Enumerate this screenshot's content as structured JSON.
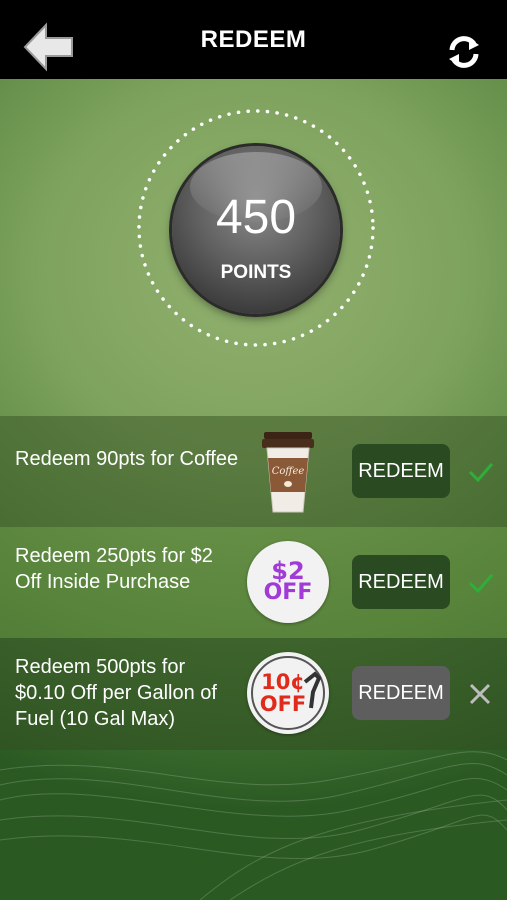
{
  "header": {
    "title": "REDEEM",
    "back_icon": "back-arrow-icon",
    "refresh_icon": "refresh-icon"
  },
  "points": {
    "value": "450",
    "label": "POINTS"
  },
  "rewards": [
    {
      "description": "Redeem 90pts for Coffee",
      "image": "coffee-cup-icon",
      "button_label": "REDEEM",
      "available": true,
      "status_icon": "check-icon"
    },
    {
      "description": "Redeem 250pts for $2 Off Inside Purchase",
      "image": "two-dollar-off-icon",
      "badge_line1": "$2",
      "badge_line2": "OFF",
      "button_label": "REDEEM",
      "available": true,
      "status_icon": "check-icon"
    },
    {
      "description": "Redeem 500pts for $0.10 Off per Gallon of Fuel (10 Gal Max)",
      "image": "ten-cent-off-fuel-icon",
      "badge_line1": "10¢",
      "badge_line2": "OFF",
      "button_label": "REDEEM",
      "available": false,
      "status_icon": "x-icon"
    }
  ],
  "colors": {
    "check": "#2fae3a",
    "x": "#bdbdbd",
    "badge_purple": "#a23ad8",
    "badge_red": "#e02b1c",
    "button_active": "#2a4a22",
    "button_disabled": "#5e5e5e"
  }
}
